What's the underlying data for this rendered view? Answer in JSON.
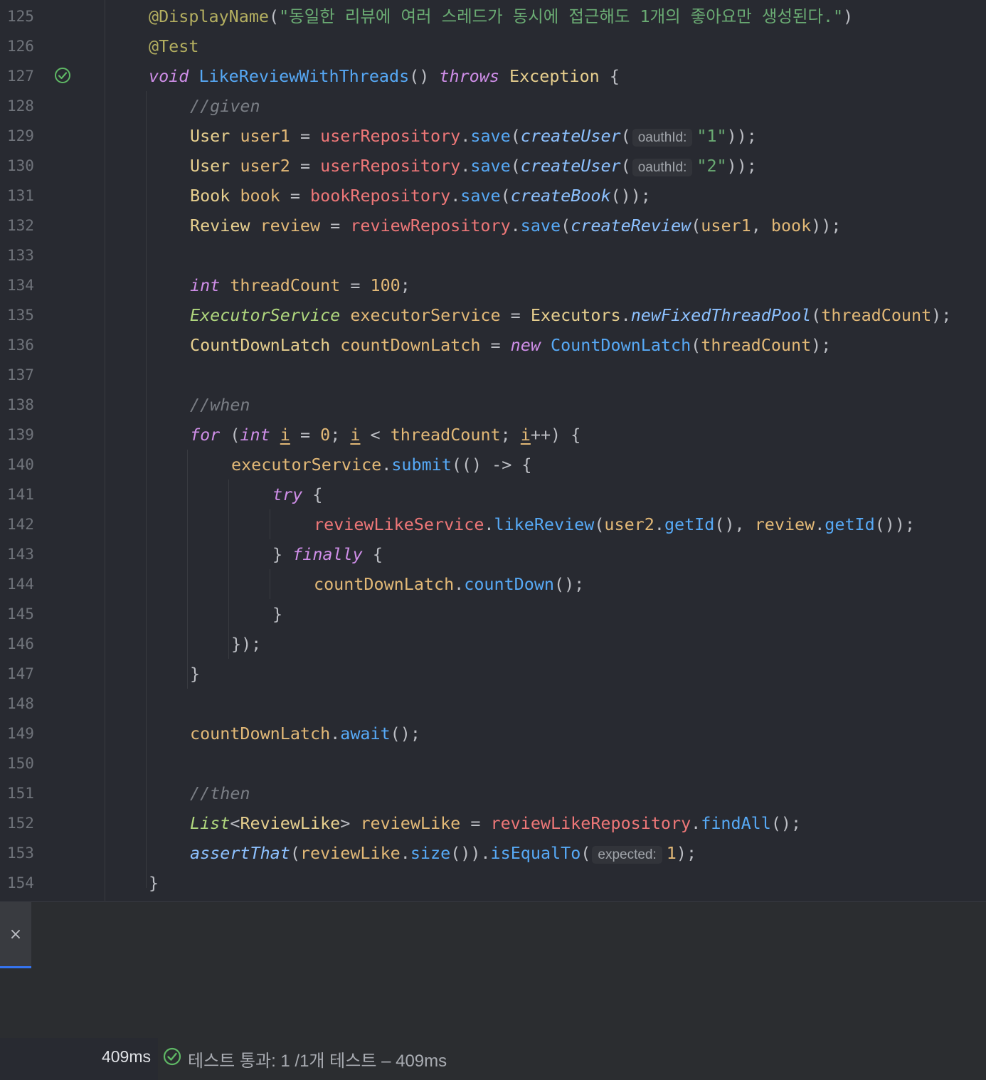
{
  "editor": {
    "line_numbers": [
      "125",
      "126",
      "127",
      "128",
      "129",
      "130",
      "131",
      "132",
      "133",
      "134",
      "135",
      "136",
      "137",
      "138",
      "139",
      "140",
      "141",
      "142",
      "143",
      "144",
      "145",
      "146",
      "147",
      "148",
      "149",
      "150",
      "151",
      "152",
      "153",
      "154"
    ],
    "gutter_icons": [
      {
        "line": "127",
        "icon": "test-passed-icon",
        "color": "#5fb865"
      }
    ],
    "lines": [
      {
        "tokens": [
          [
            "ann",
            "@DisplayName"
          ],
          [
            "pun",
            "("
          ],
          [
            "str",
            "\"동일한 리뷰에 여러 스레드가 동시에 접근해도 1개의 좋아요만 생성된다.\""
          ],
          [
            "pun",
            ")"
          ]
        ]
      },
      {
        "tokens": [
          [
            "ann",
            "@Test"
          ]
        ]
      },
      {
        "tokens": [
          [
            "kw",
            "void"
          ],
          [
            "pun",
            " "
          ],
          [
            "fn",
            "LikeReviewWithThreads"
          ],
          [
            "pun",
            "() "
          ],
          [
            "kw",
            "throws"
          ],
          [
            "pun",
            " "
          ],
          [
            "tp",
            "Exception"
          ],
          [
            "pun",
            " {"
          ]
        ]
      },
      {
        "tokens": [
          [
            "cm",
            "//given"
          ]
        ]
      },
      {
        "tokens": [
          [
            "tp",
            "User"
          ],
          [
            "pun",
            " "
          ],
          [
            "var",
            "user1"
          ],
          [
            "pun",
            " = "
          ],
          [
            "fld",
            "userRepository"
          ],
          [
            "pun",
            "."
          ],
          [
            "call",
            "save"
          ],
          [
            "pun",
            "("
          ],
          [
            "st",
            "createUser"
          ],
          [
            "pun",
            "("
          ],
          [
            "hint",
            "oauthId:"
          ],
          [
            "str",
            "\"1\""
          ],
          [
            "pun",
            "));"
          ]
        ]
      },
      {
        "tokens": [
          [
            "tp",
            "User"
          ],
          [
            "pun",
            " "
          ],
          [
            "var",
            "user2"
          ],
          [
            "pun",
            " = "
          ],
          [
            "fld",
            "userRepository"
          ],
          [
            "pun",
            "."
          ],
          [
            "call",
            "save"
          ],
          [
            "pun",
            "("
          ],
          [
            "st",
            "createUser"
          ],
          [
            "pun",
            "("
          ],
          [
            "hint",
            "oauthId:"
          ],
          [
            "str",
            "\"2\""
          ],
          [
            "pun",
            "));"
          ]
        ]
      },
      {
        "tokens": [
          [
            "tp",
            "Book"
          ],
          [
            "pun",
            " "
          ],
          [
            "var",
            "book"
          ],
          [
            "pun",
            " = "
          ],
          [
            "fld",
            "bookRepository"
          ],
          [
            "pun",
            "."
          ],
          [
            "call",
            "save"
          ],
          [
            "pun",
            "("
          ],
          [
            "st",
            "createBook"
          ],
          [
            "pun",
            "());"
          ]
        ]
      },
      {
        "tokens": [
          [
            "tp",
            "Review"
          ],
          [
            "pun",
            " "
          ],
          [
            "var",
            "review"
          ],
          [
            "pun",
            " = "
          ],
          [
            "fld",
            "reviewRepository"
          ],
          [
            "pun",
            "."
          ],
          [
            "call",
            "save"
          ],
          [
            "pun",
            "("
          ],
          [
            "st",
            "createReview"
          ],
          [
            "pun",
            "("
          ],
          [
            "var",
            "user1"
          ],
          [
            "pun",
            ", "
          ],
          [
            "var",
            "book"
          ],
          [
            "pun",
            "));"
          ]
        ]
      },
      {
        "tokens": []
      },
      {
        "tokens": [
          [
            "kw",
            "int"
          ],
          [
            "pun",
            " "
          ],
          [
            "var",
            "threadCount"
          ],
          [
            "pun",
            " = "
          ],
          [
            "num2",
            "100"
          ],
          [
            "pun",
            ";"
          ]
        ]
      },
      {
        "tokens": [
          [
            "itf",
            "ExecutorService"
          ],
          [
            "pun",
            " "
          ],
          [
            "var",
            "executorService"
          ],
          [
            "pun",
            " = "
          ],
          [
            "tp",
            "Executors"
          ],
          [
            "pun",
            "."
          ],
          [
            "st",
            "newFixedThreadPool"
          ],
          [
            "pun",
            "("
          ],
          [
            "var",
            "threadCount"
          ],
          [
            "pun",
            ");"
          ]
        ]
      },
      {
        "tokens": [
          [
            "tp",
            "CountDownLatch"
          ],
          [
            "pun",
            " "
          ],
          [
            "var",
            "countDownLatch"
          ],
          [
            "pun",
            " = "
          ],
          [
            "kw",
            "new"
          ],
          [
            "pun",
            " "
          ],
          [
            "call",
            "CountDownLatch"
          ],
          [
            "pun",
            "("
          ],
          [
            "var",
            "threadCount"
          ],
          [
            "pun",
            ");"
          ]
        ]
      },
      {
        "tokens": []
      },
      {
        "tokens": [
          [
            "cm",
            "//when"
          ]
        ]
      },
      {
        "tokens": [
          [
            "kw",
            "for"
          ],
          [
            "pun",
            " ("
          ],
          [
            "kw",
            "int"
          ],
          [
            "pun",
            " "
          ],
          [
            "var und",
            "i"
          ],
          [
            "pun",
            " = "
          ],
          [
            "num2",
            "0"
          ],
          [
            "pun",
            "; "
          ],
          [
            "var und",
            "i"
          ],
          [
            "pun",
            " < "
          ],
          [
            "var",
            "threadCount"
          ],
          [
            "pun",
            "; "
          ],
          [
            "var und",
            "i"
          ],
          [
            "pun",
            "++) {"
          ]
        ]
      },
      {
        "tokens": [
          [
            "var",
            "executorService"
          ],
          [
            "pun",
            "."
          ],
          [
            "call",
            "submit"
          ],
          [
            "pun",
            "(() -> {"
          ]
        ]
      },
      {
        "tokens": [
          [
            "kw",
            "try"
          ],
          [
            "pun",
            " {"
          ]
        ]
      },
      {
        "tokens": [
          [
            "fld",
            "reviewLikeService"
          ],
          [
            "pun",
            "."
          ],
          [
            "call",
            "likeReview"
          ],
          [
            "pun",
            "("
          ],
          [
            "var",
            "user2"
          ],
          [
            "pun",
            "."
          ],
          [
            "call",
            "getId"
          ],
          [
            "pun",
            "(), "
          ],
          [
            "var",
            "review"
          ],
          [
            "pun",
            "."
          ],
          [
            "call",
            "getId"
          ],
          [
            "pun",
            "());"
          ]
        ]
      },
      {
        "tokens": [
          [
            "pun",
            "} "
          ],
          [
            "kw",
            "finally"
          ],
          [
            "pun",
            " {"
          ]
        ]
      },
      {
        "tokens": [
          [
            "var",
            "countDownLatch"
          ],
          [
            "pun",
            "."
          ],
          [
            "call",
            "countDown"
          ],
          [
            "pun",
            "();"
          ]
        ]
      },
      {
        "tokens": [
          [
            "pun",
            "}"
          ]
        ]
      },
      {
        "tokens": [
          [
            "pun",
            "});"
          ]
        ]
      },
      {
        "tokens": [
          [
            "pun",
            "}"
          ]
        ]
      },
      {
        "tokens": []
      },
      {
        "tokens": [
          [
            "var",
            "countDownLatch"
          ],
          [
            "pun",
            "."
          ],
          [
            "call",
            "await"
          ],
          [
            "pun",
            "();"
          ]
        ]
      },
      {
        "tokens": []
      },
      {
        "tokens": [
          [
            "cm",
            "//then"
          ]
        ]
      },
      {
        "tokens": [
          [
            "itf",
            "List"
          ],
          [
            "pun",
            "<"
          ],
          [
            "tp",
            "ReviewLike"
          ],
          [
            "pun",
            "> "
          ],
          [
            "var",
            "reviewLike"
          ],
          [
            "pun",
            " = "
          ],
          [
            "fld",
            "reviewLikeRepository"
          ],
          [
            "pun",
            "."
          ],
          [
            "call",
            "findAll"
          ],
          [
            "pun",
            "();"
          ]
        ]
      },
      {
        "tokens": [
          [
            "st",
            "assertThat"
          ],
          [
            "pun",
            "("
          ],
          [
            "var",
            "reviewLike"
          ],
          [
            "pun",
            "."
          ],
          [
            "call",
            "size"
          ],
          [
            "pun",
            "())."
          ],
          [
            "call",
            "isEqualTo"
          ],
          [
            "pun",
            "("
          ],
          [
            "hint",
            "expected:"
          ],
          [
            "num2",
            "1"
          ],
          [
            "pun",
            ");"
          ]
        ]
      },
      {
        "tokens": [
          [
            "pun",
            "}"
          ]
        ]
      }
    ]
  },
  "tool_window": {
    "close_glyph": "×"
  },
  "status": {
    "duration": "409ms",
    "result_text": "테스트 통과: 1 /1개 테스트 – 409ms",
    "pass_color": "#5fb865"
  }
}
